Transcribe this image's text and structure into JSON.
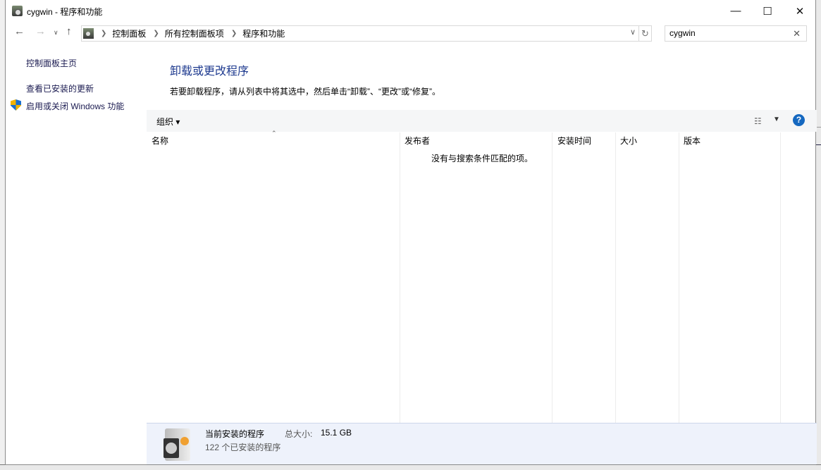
{
  "window": {
    "title": "cygwin - 程序和功能"
  },
  "address": {
    "crumbs": [
      "控制面板",
      "所有控制面板项",
      "程序和功能"
    ]
  },
  "search": {
    "value": "cygwin"
  },
  "sidebar": {
    "items": [
      {
        "label": "控制面板主页"
      },
      {
        "label": "查看已安装的更新"
      },
      {
        "label": "启用或关闭 Windows 功能"
      }
    ]
  },
  "main": {
    "heading": "卸载或更改程序",
    "description": "若要卸载程序，请从列表中将其选中，然后单击“卸载”、“更改”或“修复”。",
    "organize": "组织",
    "columns": [
      "名称",
      "发布者",
      "安装时间",
      "大小",
      "版本"
    ],
    "empty_message": "没有与搜索条件匹配的项。"
  },
  "details": {
    "title": "当前安装的程序",
    "total_label": "总大小:",
    "total_value": "15.1 GB",
    "count": "122 个已安装的程序"
  }
}
